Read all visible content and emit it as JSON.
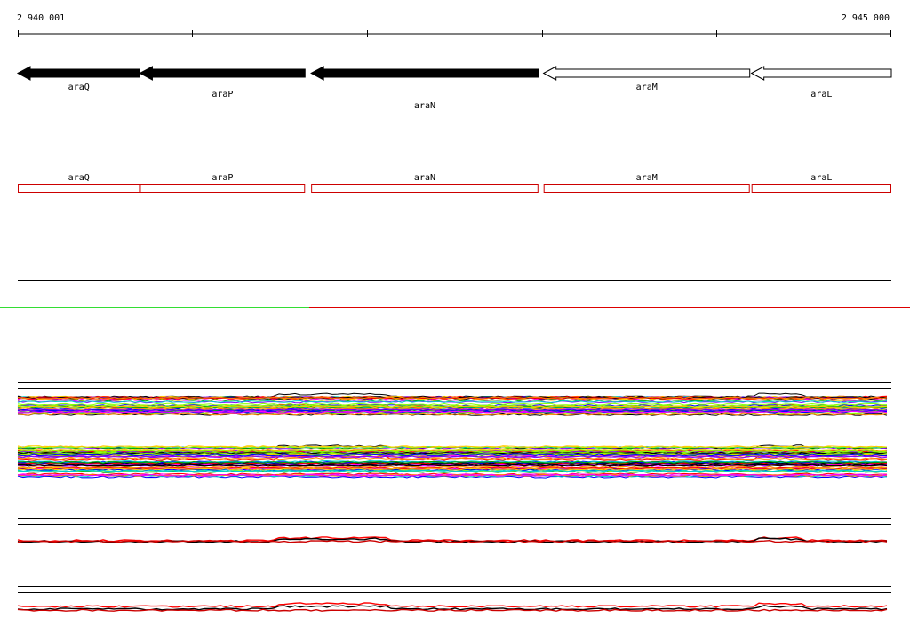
{
  "region": {
    "start": 2940001,
    "end": 2945000,
    "start_label": "2 940 001",
    "end_label": "2 945 000"
  },
  "genes": [
    {
      "name": "araQ",
      "start": 2940001,
      "end": 2940700,
      "strand": "-",
      "filled": true
    },
    {
      "name": "araP",
      "start": 2940700,
      "end": 2941645,
      "strand": "-",
      "filled": true
    },
    {
      "name": "araN",
      "start": 2941680,
      "end": 2942980,
      "strand": "-",
      "filled": true
    },
    {
      "name": "araM",
      "start": 2943010,
      "end": 2944190,
      "strand": "-",
      "filled": false
    },
    {
      "name": "araL",
      "start": 2944200,
      "end": 2945000,
      "strand": "-",
      "filled": false
    }
  ],
  "colors": {
    "gene_filled": "#000000",
    "gene_outline": "#000000",
    "feature_box": "#cc0000",
    "split_left": "#33dd33",
    "split_right": "#dd0000",
    "track_line": "#000000"
  },
  "chart_data": {
    "type": "line",
    "x_range": [
      2940001,
      2945000
    ],
    "tracks": [
      {
        "name": "",
        "series_count": 40,
        "palette": [
          "#000000",
          "#ff0000",
          "#00aa00",
          "#0000ff",
          "#ff00ff",
          "#00cccc",
          "#ff8800",
          "#88ff00",
          "#8800ff",
          "#ffcc00"
        ]
      },
      {
        "name": "",
        "series_count": 60,
        "palette": [
          "#000000",
          "#ff0000",
          "#00aa00",
          "#0000ff",
          "#ff00ff",
          "#00cccc",
          "#ff8800",
          "#88ff00",
          "#8800ff",
          "#ffcc00"
        ]
      },
      {
        "name": "",
        "series_count": 3,
        "palette": [
          "#ff0000",
          "#000000",
          "#cc0000"
        ]
      },
      {
        "name": "",
        "series_count": 3,
        "palette": [
          "#ff0000",
          "#000000",
          "#cc0000"
        ]
      }
    ]
  }
}
